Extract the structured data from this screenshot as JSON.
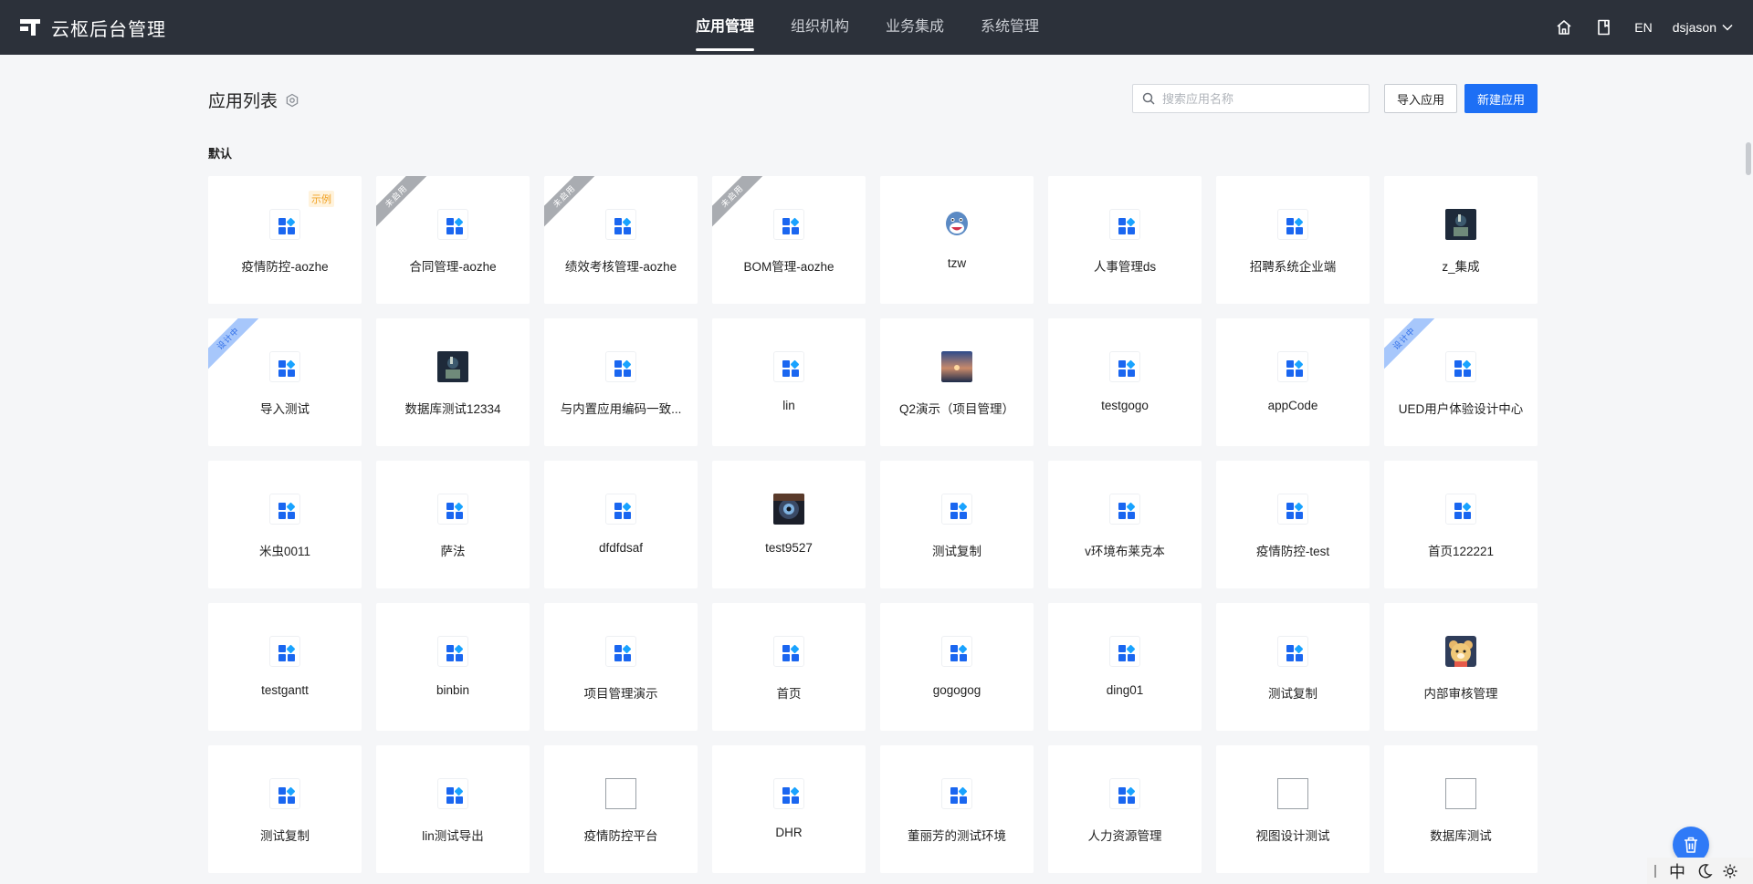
{
  "header": {
    "brand_title": "云枢后台管理",
    "nav": [
      {
        "label": "应用管理",
        "active": true
      },
      {
        "label": "组织机构",
        "active": false
      },
      {
        "label": "业务集成",
        "active": false
      },
      {
        "label": "系统管理",
        "active": false
      }
    ],
    "lang_label": "EN",
    "username": "dsjason"
  },
  "page": {
    "title": "应用列表",
    "search_placeholder": "搜索应用名称",
    "import_label": "导入应用",
    "new_label": "新建应用",
    "group_title": "默认"
  },
  "colors": {
    "topbar": "#2c313a",
    "accent": "#1d6ff5",
    "ribbon_gray": "#a9acb1",
    "ribbon_blue": "#a7c7fb",
    "example_tag": "#f0a020"
  },
  "apps": [
    {
      "name": "疫情防控-aozhe",
      "icon": "default",
      "tag": "示例"
    },
    {
      "name": "合同管理-aozhe",
      "icon": "default",
      "ribbon": "未启用",
      "ribbon_color": "gray"
    },
    {
      "name": "绩效考核管理-aozhe",
      "icon": "default",
      "ribbon": "未启用",
      "ribbon_color": "gray"
    },
    {
      "name": "BOM管理-aozhe",
      "icon": "default",
      "ribbon": "未启用",
      "ribbon_color": "gray"
    },
    {
      "name": "tzw",
      "icon": "avatar-shark"
    },
    {
      "name": "人事管理ds",
      "icon": "default"
    },
    {
      "name": "招聘系统企业端",
      "icon": "default"
    },
    {
      "name": "z_集成",
      "icon": "photo-dark"
    },
    {
      "name": "导入测试",
      "icon": "default",
      "ribbon": "设计中",
      "ribbon_color": "blue"
    },
    {
      "name": "数据库测试12334",
      "icon": "photo-dark"
    },
    {
      "name": "与内置应用编码一致...",
      "icon": "default"
    },
    {
      "name": "lin",
      "icon": "default"
    },
    {
      "name": "Q2演示（项目管理）",
      "icon": "photo-sunset"
    },
    {
      "name": "testgogo",
      "icon": "default"
    },
    {
      "name": "appCode",
      "icon": "default"
    },
    {
      "name": "UED用户体验设计中心",
      "icon": "default",
      "ribbon": "设计中",
      "ribbon_color": "blue"
    },
    {
      "name": "米虫0011",
      "icon": "default"
    },
    {
      "name": "萨法",
      "icon": "default"
    },
    {
      "name": "dfdfdsaf",
      "icon": "default"
    },
    {
      "name": "test9527",
      "icon": "photo-anime"
    },
    {
      "name": "测试复制",
      "icon": "default"
    },
    {
      "name": "v环境布莱克本",
      "icon": "default"
    },
    {
      "name": "疫情防控-test",
      "icon": "default"
    },
    {
      "name": "首页122221",
      "icon": "default"
    },
    {
      "name": "testgantt",
      "icon": "default"
    },
    {
      "name": "binbin",
      "icon": "default"
    },
    {
      "name": "项目管理演示",
      "icon": "default"
    },
    {
      "name": "首页",
      "icon": "default"
    },
    {
      "name": "gogogog",
      "icon": "default"
    },
    {
      "name": "ding01",
      "icon": "default"
    },
    {
      "name": "测试复制",
      "icon": "default"
    },
    {
      "name": "内部审核管理",
      "icon": "photo-bear"
    },
    {
      "name": "测试复制",
      "icon": "default"
    },
    {
      "name": "lin测试导出",
      "icon": "default"
    },
    {
      "name": "疫情防控平台",
      "icon": "broken"
    },
    {
      "name": "DHR",
      "icon": "default"
    },
    {
      "name": "董丽芳的测试环境",
      "icon": "default"
    },
    {
      "name": "人力资源管理",
      "icon": "default"
    },
    {
      "name": "视图设计测试",
      "icon": "broken"
    },
    {
      "name": "数据库测试",
      "icon": "broken"
    }
  ],
  "ime": {
    "label": "中"
  }
}
